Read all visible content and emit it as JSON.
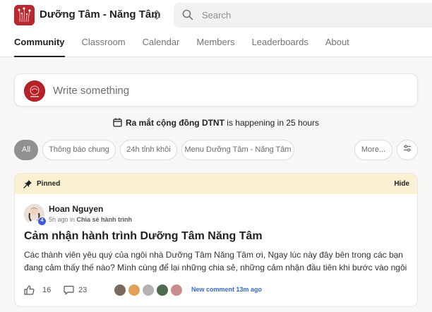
{
  "header": {
    "group_name": "Dưỡng Tâm - Năng Tâm",
    "search_placeholder": "Search"
  },
  "nav": {
    "tabs": [
      {
        "label": "Community",
        "active": true
      },
      {
        "label": "Classroom",
        "active": false
      },
      {
        "label": "Calendar",
        "active": false
      },
      {
        "label": "Members",
        "active": false
      },
      {
        "label": "Leaderboards",
        "active": false
      },
      {
        "label": "About",
        "active": false
      }
    ]
  },
  "composer": {
    "placeholder": "Write something"
  },
  "event_banner": {
    "event_name": "Ra mắt cộng đồng DTNT",
    "suffix": " is happening in 25 hours"
  },
  "filters": {
    "chips": [
      {
        "label": "All",
        "active": true
      },
      {
        "label": "Thông báo chung",
        "active": false
      },
      {
        "label": "24h tỉnh khôi",
        "active": false
      },
      {
        "label": "Menu Dưỡng Tâm - Năng Tâm",
        "active": false
      }
    ],
    "more_label": "More..."
  },
  "post": {
    "pinned_label": "Pinned",
    "hide_label": "Hide",
    "author": "Hoan Nguyen",
    "author_level": "4",
    "time": "5h ago in ",
    "category": "Chia sẻ hành trình",
    "title": "Cảm nhận hành trình Dưỡng Tâm Năng Tâm",
    "body": "Các thành viên yêu quý của ngôi nhà Dưỡng Tâm Năng Tâm ơi, Ngay lúc này đây bên trong các bạn đang cảm thấy thế nào? Mình cùng để lại những chia sẻ, những cảm nhận đầu tiên khi bước vào ngôi",
    "likes": "16",
    "comments": "23",
    "new_comment": "New comment 13m ago"
  },
  "colors": {
    "brand": "#b8282f",
    "pinned_bg": "#faf0d2",
    "link": "#3867d6",
    "chip_active": "#909090"
  }
}
